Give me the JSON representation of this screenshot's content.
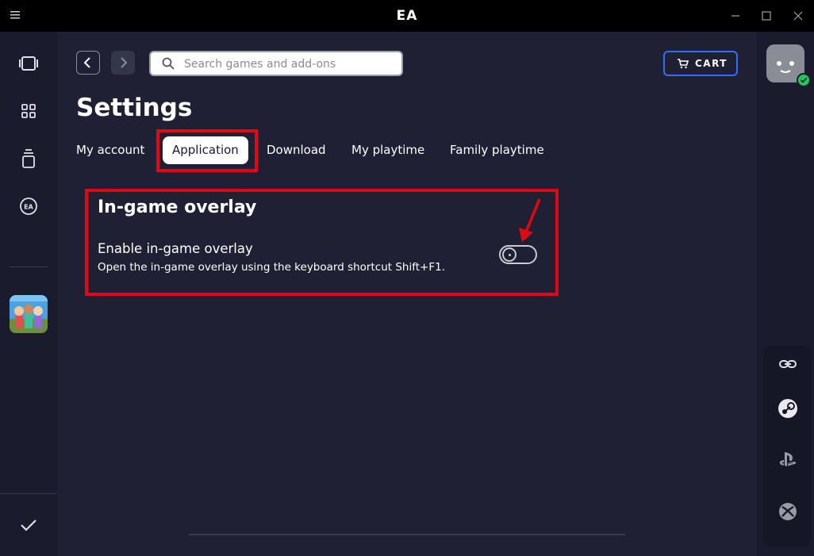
{
  "titlebar": {
    "app_title": "EA"
  },
  "toolbar": {
    "search_placeholder": "Search games and add-ons",
    "cart_label": "CART"
  },
  "page": {
    "title": "Settings"
  },
  "tabs": [
    {
      "label": "My account",
      "active": false
    },
    {
      "label": "Application",
      "active": true
    },
    {
      "label": "Download",
      "active": false
    },
    {
      "label": "My playtime",
      "active": false
    },
    {
      "label": "Family playtime",
      "active": false
    }
  ],
  "section": {
    "title": "In-game overlay",
    "setting_label": "Enable in-game overlay",
    "setting_desc": "Open the in-game overlay using the keyboard shortcut Shift+F1.",
    "toggle_on": false
  },
  "icons": {
    "left_nav": [
      "discover-icon",
      "library-icon",
      "downloads-icon",
      "ea-play-icon",
      "game-thumbnail",
      "checkmark-icon"
    ],
    "right_bar": [
      "link-icon",
      "steam-icon",
      "playstation-icon",
      "xbox-icon"
    ]
  },
  "colors": {
    "background": "#1f2033",
    "highlight": "#e30613",
    "cart_border": "#2f6fff",
    "status": "#22c55e"
  }
}
